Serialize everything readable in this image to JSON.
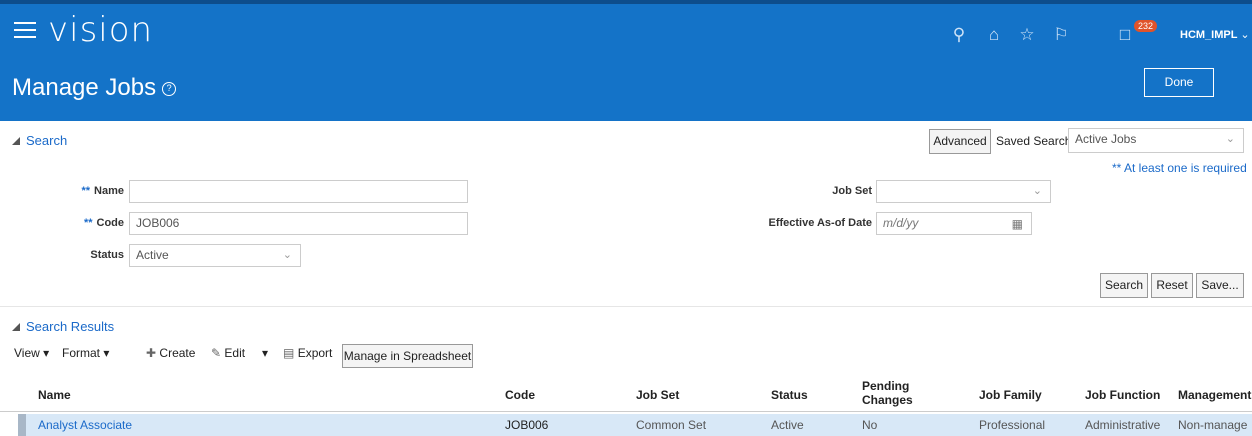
{
  "app": {
    "brand": "vision",
    "notifications_count": "232",
    "user": "HCM_IMPL"
  },
  "page": {
    "title": "Manage Jobs",
    "done_label": "Done"
  },
  "search": {
    "section_label": "Search",
    "advanced_label": "Advanced",
    "saved_search_label": "Saved Search",
    "saved_search_value": "Active Jobs",
    "required_note": "** At least one is required",
    "name_label": "Name",
    "name_value": "",
    "code_label": "Code",
    "code_value": "JOB006",
    "status_label": "Status",
    "status_value": "Active",
    "job_set_label": "Job Set",
    "job_set_value": "",
    "eff_date_label": "Effective As-of Date",
    "eff_date_placeholder": "m/d/yy",
    "required_marker": "**",
    "search_btn": "Search",
    "reset_btn": "Reset",
    "save_btn": "Save..."
  },
  "results": {
    "section_label": "Search Results",
    "toolbar": {
      "view": "View",
      "format": "Format",
      "create": "Create",
      "edit": "Edit",
      "export": "Export",
      "spreadsheet": "Manage in Spreadsheet"
    },
    "columns": [
      "Name",
      "Code",
      "Job Set",
      "Status",
      "Pending Changes",
      "Job Family",
      "Job Function",
      "Management"
    ],
    "rows": [
      [
        "Analyst Associate",
        "JOB006",
        "Common Set",
        "Active",
        "No",
        "Professional",
        "Administrative",
        "Non-manage"
      ]
    ]
  },
  "colors": {
    "header_blue": "#1473c8",
    "link_blue": "#1b6ac9",
    "row_highlight": "#d8e8f7"
  },
  "icons": [
    "menu-icon",
    "search-icon",
    "home-icon",
    "star-icon",
    "flag-icon",
    "notification-icon",
    "help-icon",
    "calendar-icon"
  ]
}
